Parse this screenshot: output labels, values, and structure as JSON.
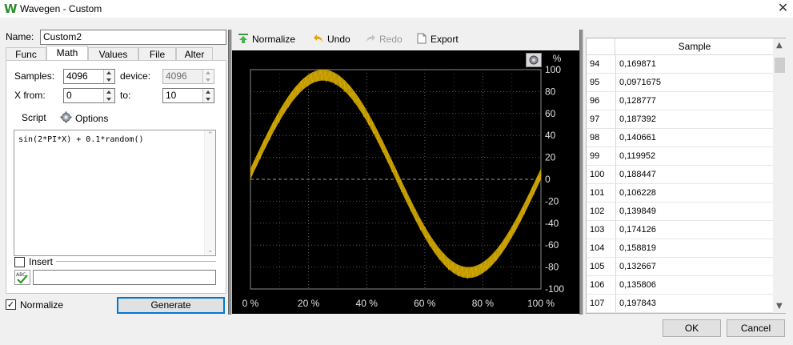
{
  "window": {
    "title": "Wavegen - Custom",
    "app_icon": "W",
    "close_glyph": "✕"
  },
  "left": {
    "name_label": "Name:",
    "name_value": "Custom2",
    "tabs": [
      "Func",
      "Math",
      "Values",
      "File",
      "Alter"
    ],
    "active_tab": "Math",
    "samples_label": "Samples:",
    "samples_value": "4096",
    "device_label": "device:",
    "device_value": "4096",
    "xfrom_label": "X from:",
    "xfrom_value": "0",
    "to_label": "to:",
    "to_value": "10",
    "script_tab": "Script",
    "options_tab": "Options",
    "script_text": "sin(2*PI*X) + 0.1*random()",
    "insert_label": "Insert",
    "insert_value": "",
    "normalize_label": "Normalize",
    "normalize_checked": "✓",
    "generate_label": "Generate"
  },
  "toolbar": {
    "normalize": "Normalize",
    "undo": "Undo",
    "redo": "Redo",
    "export": "Export"
  },
  "chart_data": {
    "type": "line",
    "title": "",
    "xlabel": "",
    "ylabel": "%",
    "xlim": [
      0,
      100
    ],
    "ylim": [
      -100,
      100
    ],
    "x_ticks": [
      "0 %",
      "20 %",
      "40 %",
      "60 %",
      "80 %",
      "100 %"
    ],
    "y_ticks": [
      "100",
      "80",
      "60",
      "40",
      "20",
      "0",
      "-20",
      "-40",
      "-60",
      "-80",
      "-100"
    ],
    "grid": true,
    "line_color": "#c8a000",
    "background": "#000000",
    "series": [
      {
        "function": "sin(2*PI*X) + 0.1*random()",
        "x_percent": [
          0,
          5,
          10,
          15,
          20,
          25,
          30,
          35,
          40,
          45,
          50,
          55,
          60,
          65,
          70,
          75,
          80,
          85,
          90,
          95,
          100
        ],
        "y_percent": [
          0,
          31,
          59,
          81,
          95,
          100,
          95,
          81,
          59,
          31,
          0,
          -31,
          -59,
          -81,
          -95,
          -100,
          -95,
          -81,
          -59,
          -31,
          0
        ],
        "noise_band_percent": 10
      }
    ]
  },
  "table": {
    "header": "Sample",
    "rows": [
      {
        "idx": "94",
        "val": "0,169871"
      },
      {
        "idx": "95",
        "val": "0,0971675"
      },
      {
        "idx": "96",
        "val": "0,128777"
      },
      {
        "idx": "97",
        "val": "0,187392"
      },
      {
        "idx": "98",
        "val": "0,140661"
      },
      {
        "idx": "99",
        "val": "0,119952"
      },
      {
        "idx": "100",
        "val": "0,188447"
      },
      {
        "idx": "101",
        "val": "0,106228"
      },
      {
        "idx": "102",
        "val": "0,139849"
      },
      {
        "idx": "103",
        "val": "0,174126"
      },
      {
        "idx": "104",
        "val": "0,158819"
      },
      {
        "idx": "105",
        "val": "0,132667"
      },
      {
        "idx": "106",
        "val": "0,135806"
      },
      {
        "idx": "107",
        "val": "0,197843"
      }
    ]
  },
  "footer": {
    "ok": "OK",
    "cancel": "Cancel"
  }
}
